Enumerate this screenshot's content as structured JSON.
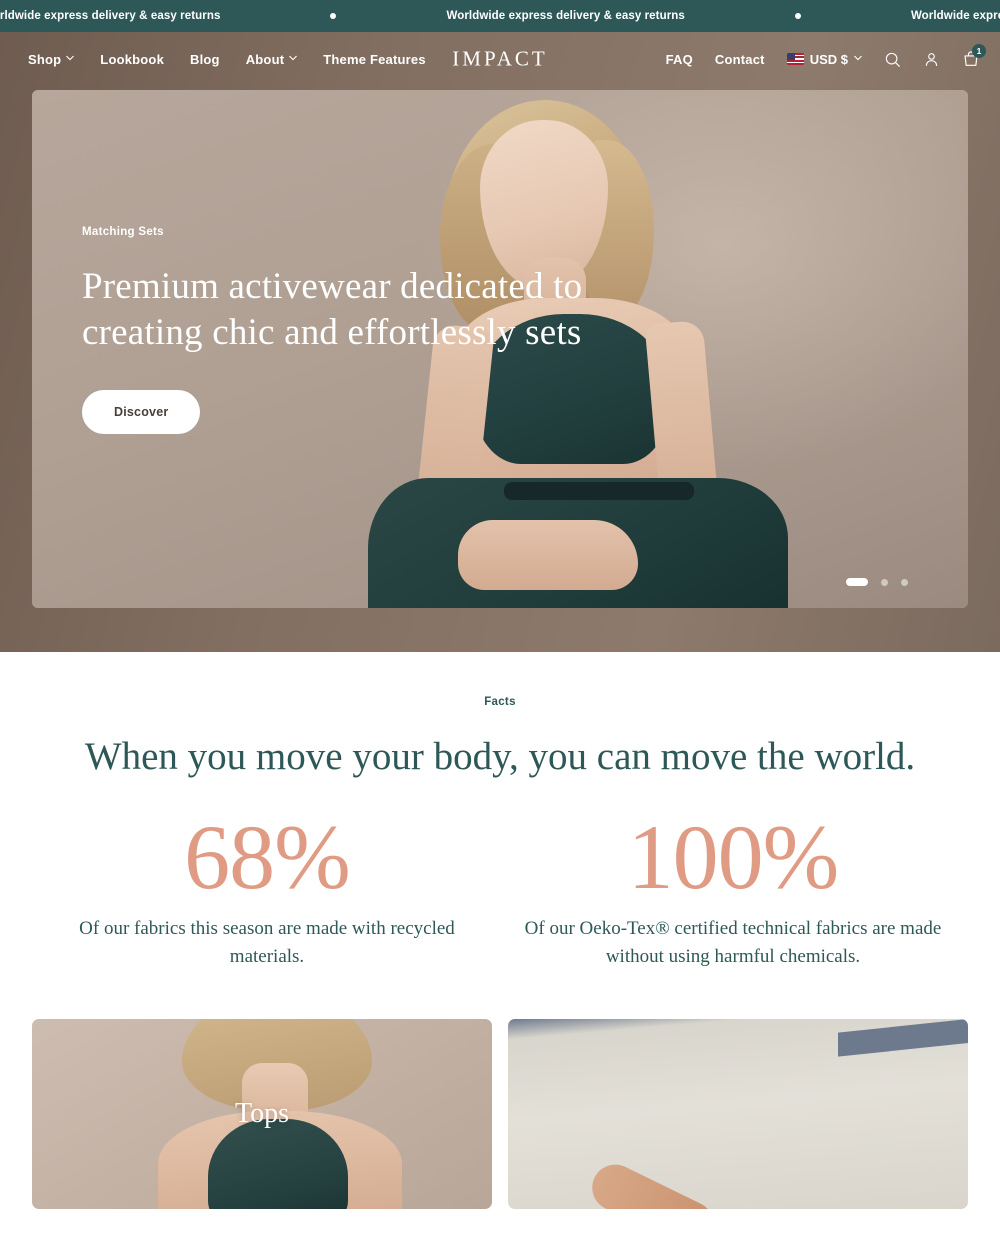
{
  "announcement": {
    "message": "Worldwide express delivery & easy returns",
    "separator_icon": "dot-bullet",
    "repeat": 4,
    "background_color": "#2e5858",
    "text_color": "#ffffff"
  },
  "header": {
    "logo": "IMPACT",
    "background_color": "#7a6759",
    "nav_left": [
      {
        "label": "Shop",
        "has_dropdown": true,
        "icon": "chevron-down-icon"
      },
      {
        "label": "Lookbook",
        "has_dropdown": false
      },
      {
        "label": "Blog",
        "has_dropdown": false
      },
      {
        "label": "About",
        "has_dropdown": true,
        "icon": "chevron-down-icon"
      },
      {
        "label": "Theme Features",
        "has_dropdown": false
      }
    ],
    "nav_right": [
      {
        "label": "FAQ"
      },
      {
        "label": "Contact"
      }
    ],
    "currency": {
      "label": "USD $",
      "flag_icon": "us-flag-icon",
      "chevron_icon": "chevron-down-icon"
    },
    "icons": [
      {
        "name": "search-icon",
        "label": "Search"
      },
      {
        "name": "account-icon",
        "label": "Account"
      },
      {
        "name": "cart-icon",
        "label": "Cart"
      }
    ],
    "cart_count": "1"
  },
  "hero": {
    "eyebrow": "Matching Sets",
    "title": "Premium activewear dedicated to creating chic and effortlessly sets",
    "button_label": "Discover",
    "slides_total": 3,
    "active_slide": 1
  },
  "facts": {
    "eyebrow": "Facts",
    "title": "When you move your body, you can move the world.",
    "accent_color": "#e09b84",
    "text_color": "#2e5858",
    "stats": [
      {
        "number": "68%",
        "description": "Of our fabrics this season are made with recycled materials."
      },
      {
        "number": "100%",
        "description": "Of our Oeko-Tex® certified technical fabrics are made without using harmful chemicals."
      }
    ]
  },
  "collections": [
    {
      "label": "Tops"
    },
    {
      "label": ""
    }
  ]
}
